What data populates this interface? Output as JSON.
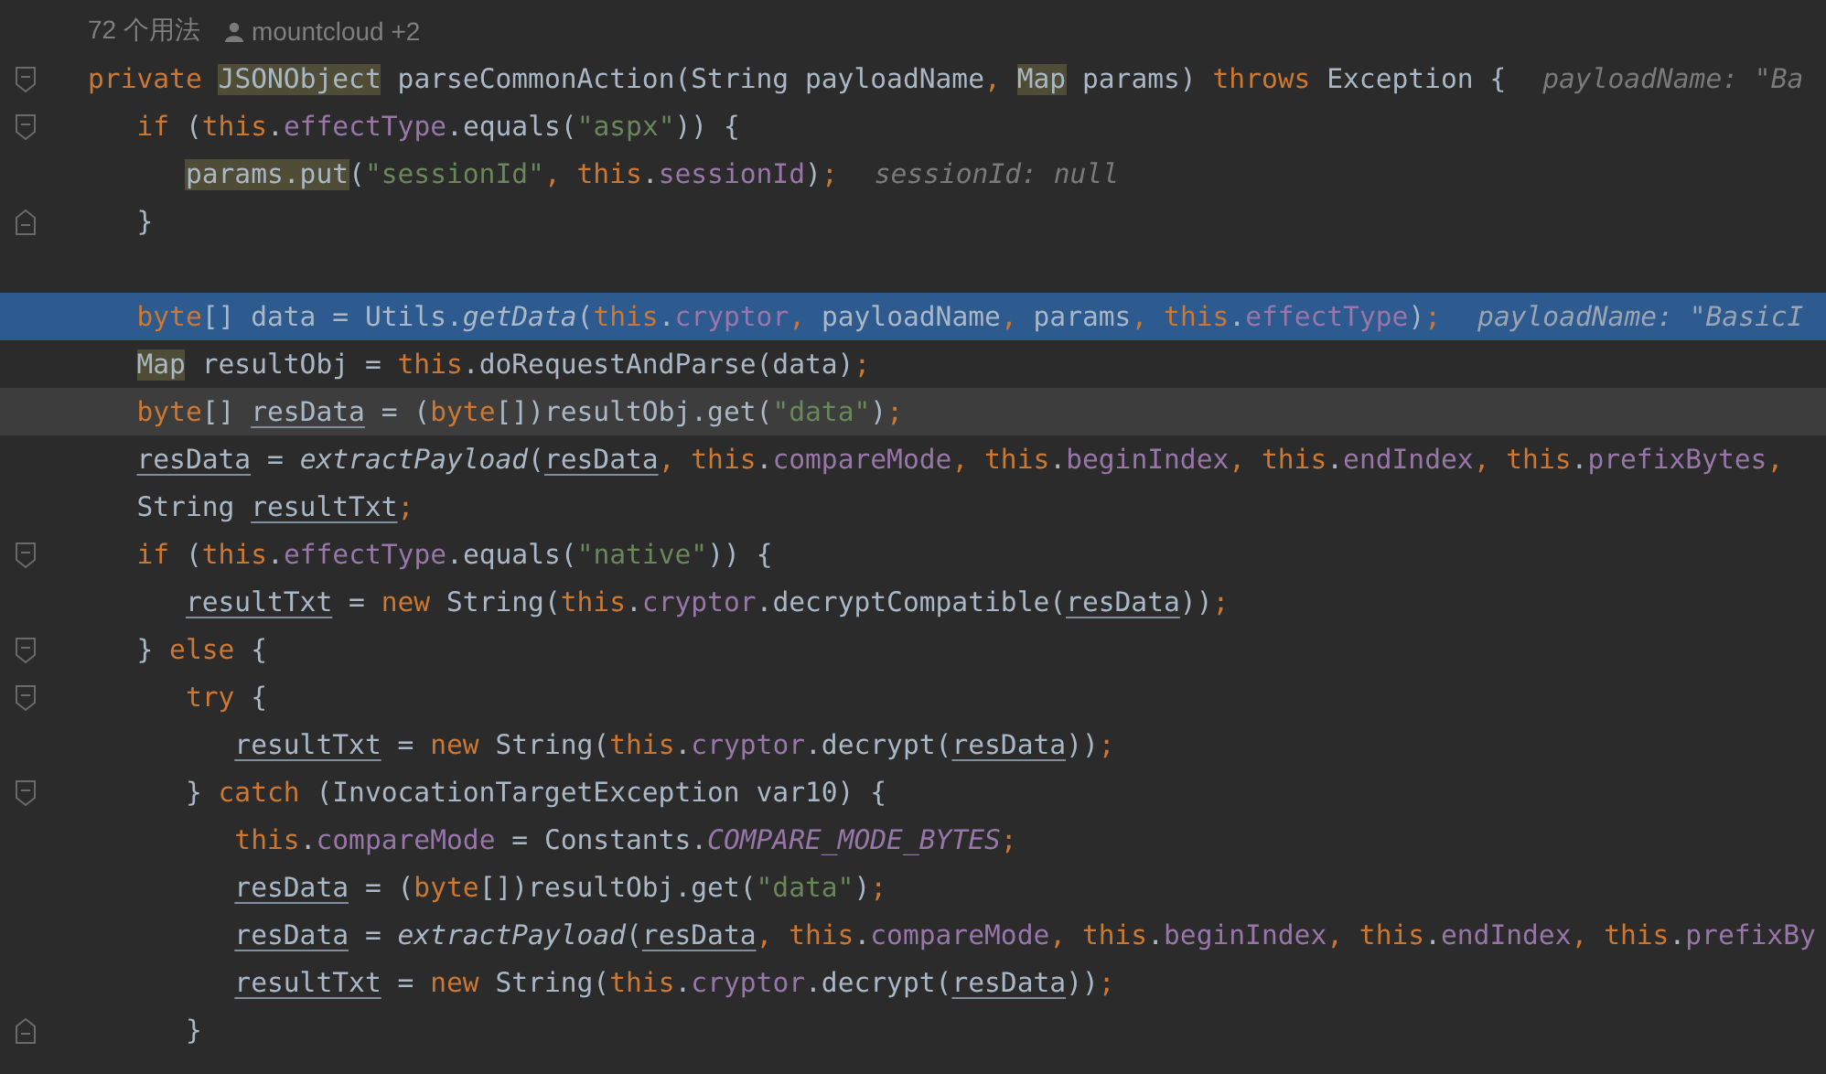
{
  "editor": {
    "meta": {
      "usages": "72 个用法",
      "author": "mountcloud +2"
    },
    "lines": [
      {
        "kind": "opener",
        "selected": false,
        "caret_line": false,
        "tokens": [
          {
            "kind": "keyword",
            "text": "private "
          },
          {
            "kind": "usage",
            "text": "JSONObject"
          },
          {
            "kind": "plain",
            "text": " parseCommonAction(String payloadName"
          },
          {
            "kind": "keyword",
            "text": ", "
          },
          {
            "kind": "usage",
            "text": "Map"
          },
          {
            "kind": "plain",
            "text": " params) "
          },
          {
            "kind": "keyword",
            "text": "throws "
          },
          {
            "kind": "plain",
            "text": "Exception {"
          }
        ],
        "hint": "payloadName: \"Ba",
        "children": [
          {
            "kind": "opener",
            "selected": false,
            "caret_line": false,
            "tokens": [
              {
                "kind": "keyword",
                "text": "if "
              },
              {
                "kind": "plain",
                "text": "("
              },
              {
                "kind": "keyword",
                "text": "this"
              },
              {
                "kind": "plain",
                "text": "."
              },
              {
                "kind": "field",
                "text": "effectType"
              },
              {
                "kind": "plain",
                "text": ".equals("
              },
              {
                "kind": "string",
                "text": "\"aspx\""
              },
              {
                "kind": "plain",
                "text": ")) {"
              }
            ],
            "children": [
              {
                "kind": "code",
                "selected": false,
                "caret_line": false,
                "tokens": [
                  {
                    "kind": "usage",
                    "text": "params.put"
                  },
                  {
                    "kind": "plain",
                    "text": "("
                  },
                  {
                    "kind": "string",
                    "text": "\"sessionId\""
                  },
                  {
                    "kind": "keyword",
                    "text": ", this"
                  },
                  {
                    "kind": "plain",
                    "text": "."
                  },
                  {
                    "kind": "field",
                    "text": "sessionId"
                  },
                  {
                    "kind": "plain",
                    "text": ")"
                  },
                  {
                    "kind": "keyword",
                    "text": ";"
                  }
                ],
                "hint": "sessionId: null"
              }
            ]
          },
          {
            "kind": "closer",
            "selected": false,
            "caret_line": false,
            "tokens": [
              {
                "kind": "plain",
                "text": "}"
              }
            ]
          },
          {
            "kind": "code",
            "selected": false,
            "caret_line": false
          },
          {
            "kind": "code",
            "selected": true,
            "caret_line": false,
            "tokens": [
              {
                "kind": "keyword",
                "text": "byte"
              },
              {
                "kind": "plain",
                "text": "[] data = Utils."
              },
              {
                "kind": "static_call",
                "text": "getData"
              },
              {
                "kind": "plain",
                "text": "("
              },
              {
                "kind": "keyword",
                "text": "this"
              },
              {
                "kind": "plain",
                "text": "."
              },
              {
                "kind": "field",
                "text": "cryptor"
              },
              {
                "kind": "keyword",
                "text": ", "
              },
              {
                "kind": "plain",
                "text": "payloadName"
              },
              {
                "kind": "keyword",
                "text": ", "
              },
              {
                "kind": "plain",
                "text": "params"
              },
              {
                "kind": "keyword",
                "text": ", this"
              },
              {
                "kind": "plain",
                "text": "."
              },
              {
                "kind": "field",
                "text": "effectType"
              },
              {
                "kind": "plain",
                "text": ")"
              },
              {
                "kind": "keyword",
                "text": ";"
              }
            ],
            "hint": "payloadName: \"BasicI"
          },
          {
            "kind": "code",
            "selected": false,
            "caret_line": false,
            "tokens": [
              {
                "kind": "usage",
                "text": "Map"
              },
              {
                "kind": "plain",
                "text": " resultObj = "
              },
              {
                "kind": "keyword",
                "text": "this"
              },
              {
                "kind": "plain",
                "text": ".doRequestAndParse(data)"
              },
              {
                "kind": "keyword",
                "text": ";"
              }
            ]
          },
          {
            "kind": "code",
            "selected": false,
            "caret_line": true,
            "tokens": [
              {
                "kind": "keyword",
                "text": "byte"
              },
              {
                "kind": "plain",
                "text": "[] "
              },
              {
                "kind": "variable",
                "text": "resData"
              },
              {
                "kind": "plain",
                "text": " = ("
              },
              {
                "kind": "keyword",
                "text": "byte"
              },
              {
                "kind": "plain",
                "text": "[])resultObj.get("
              },
              {
                "kind": "string",
                "text": "\"data\""
              },
              {
                "kind": "plain",
                "text": ")"
              },
              {
                "kind": "keyword",
                "text": ";"
              }
            ]
          },
          {
            "kind": "code",
            "selected": false,
            "caret_line": false,
            "tokens": [
              {
                "kind": "variable",
                "text": "resData"
              },
              {
                "kind": "plain",
                "text": " = "
              },
              {
                "kind": "static_call",
                "text": "extractPayload"
              },
              {
                "kind": "plain",
                "text": "("
              },
              {
                "kind": "variable",
                "text": "resData"
              },
              {
                "kind": "keyword",
                "text": ", this"
              },
              {
                "kind": "plain",
                "text": "."
              },
              {
                "kind": "field",
                "text": "compareMode"
              },
              {
                "kind": "keyword",
                "text": ", this"
              },
              {
                "kind": "plain",
                "text": "."
              },
              {
                "kind": "field",
                "text": "beginIndex"
              },
              {
                "kind": "keyword",
                "text": ", this"
              },
              {
                "kind": "plain",
                "text": "."
              },
              {
                "kind": "field",
                "text": "endIndex"
              },
              {
                "kind": "keyword",
                "text": ", this"
              },
              {
                "kind": "plain",
                "text": "."
              },
              {
                "kind": "field",
                "text": "prefixBytes"
              },
              {
                "kind": "keyword",
                "text": ","
              }
            ]
          },
          {
            "kind": "code",
            "selected": false,
            "caret_line": false,
            "tokens": [
              {
                "kind": "plain",
                "text": "String "
              },
              {
                "kind": "variable",
                "text": "resultTxt"
              },
              {
                "kind": "keyword",
                "text": ";"
              }
            ]
          },
          {
            "kind": "opener",
            "selected": false,
            "caret_line": false,
            "tokens": [
              {
                "kind": "keyword",
                "text": "if "
              },
              {
                "kind": "plain",
                "text": "("
              },
              {
                "kind": "keyword",
                "text": "this"
              },
              {
                "kind": "plain",
                "text": "."
              },
              {
                "kind": "field",
                "text": "effectType"
              },
              {
                "kind": "plain",
                "text": ".equals("
              },
              {
                "kind": "string",
                "text": "\"native\""
              },
              {
                "kind": "plain",
                "text": ")) {"
              }
            ],
            "children": [
              {
                "kind": "code",
                "selected": false,
                "caret_line": false,
                "tokens": [
                  {
                    "kind": "variable",
                    "text": "resultTxt"
                  },
                  {
                    "kind": "plain",
                    "text": " = "
                  },
                  {
                    "kind": "keyword",
                    "text": "new "
                  },
                  {
                    "kind": "plain",
                    "text": "String("
                  },
                  {
                    "kind": "keyword",
                    "text": "this"
                  },
                  {
                    "kind": "plain",
                    "text": "."
                  },
                  {
                    "kind": "field",
                    "text": "cryptor"
                  },
                  {
                    "kind": "plain",
                    "text": ".decryptCompatible("
                  },
                  {
                    "kind": "variable",
                    "text": "resData"
                  },
                  {
                    "kind": "plain",
                    "text": "))"
                  },
                  {
                    "kind": "keyword",
                    "text": ";"
                  }
                ]
              }
            ]
          },
          {
            "kind": "opener",
            "selected": false,
            "caret_line": false,
            "tokens": [
              {
                "kind": "plain",
                "text": "} "
              },
              {
                "kind": "keyword",
                "text": "else "
              },
              {
                "kind": "plain",
                "text": "{"
              }
            ],
            "children": [
              {
                "kind": "opener",
                "selected": false,
                "caret_line": false,
                "tokens": [
                  {
                    "kind": "keyword",
                    "text": "try "
                  },
                  {
                    "kind": "plain",
                    "text": "{"
                  }
                ],
                "children": [
                  {
                    "kind": "code",
                    "selected": false,
                    "caret_line": false,
                    "tokens": [
                      {
                        "kind": "variable",
                        "text": "resultTxt"
                      },
                      {
                        "kind": "plain",
                        "text": " = "
                      },
                      {
                        "kind": "keyword",
                        "text": "new "
                      },
                      {
                        "kind": "plain",
                        "text": "String("
                      },
                      {
                        "kind": "keyword",
                        "text": "this"
                      },
                      {
                        "kind": "plain",
                        "text": "."
                      },
                      {
                        "kind": "field",
                        "text": "cryptor"
                      },
                      {
                        "kind": "plain",
                        "text": ".decrypt("
                      },
                      {
                        "kind": "variable",
                        "text": "resData"
                      },
                      {
                        "kind": "plain",
                        "text": "))"
                      },
                      {
                        "kind": "keyword",
                        "text": ";"
                      }
                    ]
                  }
                ]
              },
              {
                "kind": "opener",
                "selected": false,
                "caret_line": false,
                "tokens": [
                  {
                    "kind": "plain",
                    "text": "} "
                  },
                  {
                    "kind": "keyword",
                    "text": "catch "
                  },
                  {
                    "kind": "plain",
                    "text": "(InvocationTargetException var10) {"
                  }
                ],
                "children": [
                  {
                    "kind": "code",
                    "selected": false,
                    "caret_line": false,
                    "tokens": [
                      {
                        "kind": "keyword",
                        "text": "this"
                      },
                      {
                        "kind": "plain",
                        "text": "."
                      },
                      {
                        "kind": "field",
                        "text": "compareMode"
                      },
                      {
                        "kind": "plain",
                        "text": " = Constants."
                      },
                      {
                        "kind": "constant",
                        "text": "COMPARE_MODE_BYTES"
                      },
                      {
                        "kind": "keyword",
                        "text": ";"
                      }
                    ]
                  },
                  {
                    "kind": "code",
                    "selected": false,
                    "caret_line": false,
                    "tokens": [
                      {
                        "kind": "variable",
                        "text": "resData"
                      },
                      {
                        "kind": "plain",
                        "text": " = ("
                      },
                      {
                        "kind": "keyword",
                        "text": "byte"
                      },
                      {
                        "kind": "plain",
                        "text": "[])resultObj.get("
                      },
                      {
                        "kind": "string",
                        "text": "\"data\""
                      },
                      {
                        "kind": "plain",
                        "text": ")"
                      },
                      {
                        "kind": "keyword",
                        "text": ";"
                      }
                    ]
                  },
                  {
                    "kind": "code",
                    "selected": false,
                    "caret_line": false,
                    "tokens": [
                      {
                        "kind": "variable",
                        "text": "resData"
                      },
                      {
                        "kind": "plain",
                        "text": " = "
                      },
                      {
                        "kind": "static_call",
                        "text": "extractPayload"
                      },
                      {
                        "kind": "plain",
                        "text": "("
                      },
                      {
                        "kind": "variable",
                        "text": "resData"
                      },
                      {
                        "kind": "keyword",
                        "text": ", this"
                      },
                      {
                        "kind": "plain",
                        "text": "."
                      },
                      {
                        "kind": "field",
                        "text": "compareMode"
                      },
                      {
                        "kind": "keyword",
                        "text": ", this"
                      },
                      {
                        "kind": "plain",
                        "text": "."
                      },
                      {
                        "kind": "field",
                        "text": "beginIndex"
                      },
                      {
                        "kind": "keyword",
                        "text": ", this"
                      },
                      {
                        "kind": "plain",
                        "text": "."
                      },
                      {
                        "kind": "field",
                        "text": "endIndex"
                      },
                      {
                        "kind": "keyword",
                        "text": ", this"
                      },
                      {
                        "kind": "plain",
                        "text": "."
                      },
                      {
                        "kind": "field",
                        "text": "prefixBy"
                      }
                    ]
                  },
                  {
                    "kind": "code",
                    "selected": false,
                    "caret_line": false,
                    "tokens": [
                      {
                        "kind": "variable",
                        "text": "resultTxt"
                      },
                      {
                        "kind": "plain",
                        "text": " = "
                      },
                      {
                        "kind": "keyword",
                        "text": "new "
                      },
                      {
                        "kind": "plain",
                        "text": "String("
                      },
                      {
                        "kind": "keyword",
                        "text": "this"
                      },
                      {
                        "kind": "plain",
                        "text": "."
                      },
                      {
                        "kind": "field",
                        "text": "cryptor"
                      },
                      {
                        "kind": "plain",
                        "text": ".decrypt("
                      },
                      {
                        "kind": "variable",
                        "text": "resData"
                      },
                      {
                        "kind": "plain",
                        "text": "))"
                      },
                      {
                        "kind": "keyword",
                        "text": ";"
                      }
                    ]
                  }
                ]
              },
              {
                "kind": "closer",
                "selected": false,
                "caret_line": false,
                "tokens": [
                  {
                    "kind": "plain",
                    "text": "}"
                  }
                ]
              }
            ]
          }
        ]
      }
    ]
  }
}
